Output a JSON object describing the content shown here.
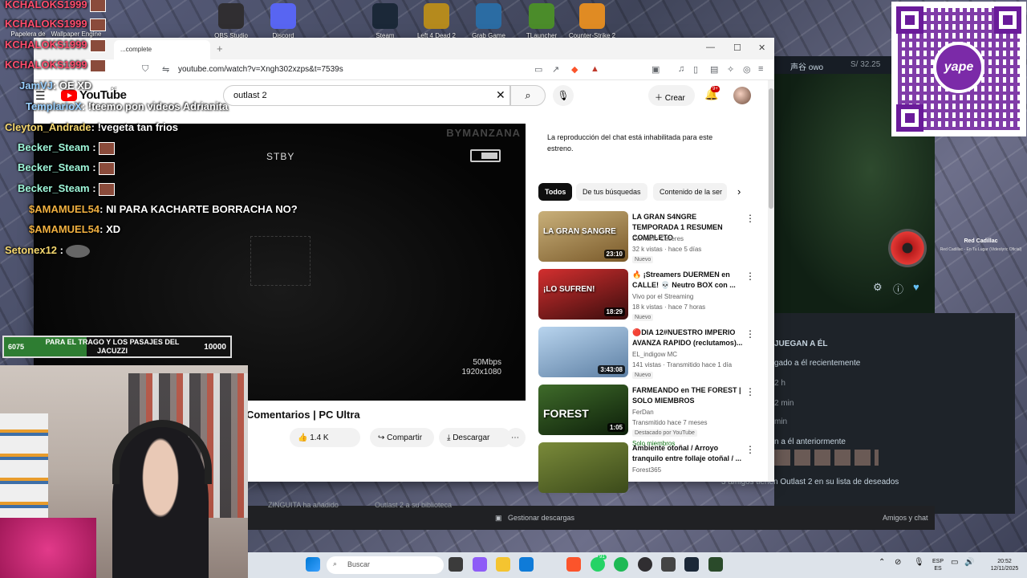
{
  "desktop": {
    "icons": [
      {
        "label": "OBS Studio",
        "color": "#302e31"
      },
      {
        "label": "Discord",
        "color": "#5865f2"
      },
      {
        "label": "Steam",
        "color": "#1b2838"
      },
      {
        "label": "Left 4 Dead 2",
        "color": "#b58a1d"
      },
      {
        "label": "Grab Game",
        "color": "#2b6ca3"
      },
      {
        "label": "TLauncher",
        "color": "#4b8c2a"
      },
      {
        "label": "Counter-Strike 2",
        "color": "#e08b23"
      }
    ],
    "left_labels": [
      "Papelera de",
      "Wallpaper Engine"
    ]
  },
  "browser": {
    "tab_title": "...complete",
    "url": "youtube.com/watch?v=Xngh302xzps&t=7539s"
  },
  "youtube": {
    "logo": "YouTube",
    "country": "PE",
    "search_value": "outlast 2",
    "create_label": "Crear",
    "notif_count": "9+",
    "player": {
      "brand": "BYMANZANA",
      "stby": "STBY",
      "bitrate": "50Mbps",
      "resolution": "1920x1080"
    },
    "video_title": "Comentarios | PC Ultra",
    "likes": "1.4 K",
    "share_label": "Compartir",
    "download_label": "Descargar",
    "chat_note": "La reproducción del chat está inhabilitada para este estreno.",
    "chips": [
      "Todos",
      "De tus búsquedas",
      "Contenido de la ser"
    ],
    "recommendations": [
      {
        "title": "LA GRAN S4NGRE TEMPORADA 1 RESUMEN COMPLETO",
        "channel": "Carnalito Caceres",
        "meta": "32 k vistas · hace 5 días",
        "badge": "Nuevo",
        "duration": "23:10",
        "thumb_text": "LA GRAN SANGRE",
        "c1": "#c9b07a",
        "c2": "#7a5a2a"
      },
      {
        "title": "🔥 ¡Streamers DUERMEN en CALLE! 💀 Neutro BOX con ...",
        "channel": "Vivo por el Streaming",
        "meta": "18 k vistas · hace 7 horas",
        "badge": "Nuevo",
        "duration": "18:29",
        "thumb_text": "¡LO SUFREN!",
        "c1": "#d32f2f",
        "c2": "#3a0d0d"
      },
      {
        "title": "🔴DIA 12#NUESTRO IMPERIO AVANZA RAPIDO (reclutamos)...",
        "channel": "EL_indigow MC",
        "meta": "141 vistas · Transmitido hace 1 día",
        "badge": "Nuevo",
        "duration": "3:43:08",
        "thumb_text": "",
        "c1": "#b8d4ee",
        "c2": "#5d7fa3"
      },
      {
        "title": "FARMEANDO en THE FOREST | SOLO MIEMBROS",
        "channel": "FerDan",
        "meta": "Transmitido hace 7 meses",
        "badge": "Destacado por YouTube",
        "extra": "Solo miembros",
        "duration": "1:05",
        "thumb_text": "FOREST",
        "c1": "#3f6b2a",
        "c2": "#0d1f0a"
      },
      {
        "title": "Ambiente otoñal / Arroyo tranquilo entre follaje otoñal / ...",
        "channel": "Forest365",
        "meta": "",
        "badge": "",
        "duration": "",
        "thumb_text": "",
        "c1": "#7a8a3a",
        "c2": "#3b4a1a"
      }
    ]
  },
  "overlay": {
    "top_names": [
      "KCHALOKS1999",
      "KCHALOKS1999",
      "KCHALOKS1999",
      "KCHALOKS1999"
    ],
    "chat": [
      {
        "name": "JamVJ",
        "msg": ": OE XD",
        "color": "#9ad0ff"
      },
      {
        "name": "TemplarioX",
        "msg": ": !teemo pon videos Adrianita",
        "color": "#9ad0ff"
      },
      {
        "name": "Cleyton_Andrade",
        "msg": ": !vegeta tan frios",
        "color": "#f5d76e"
      },
      {
        "name": "Becker_Steam",
        "msg": " :",
        "color": "#9ef5d8"
      },
      {
        "name": "Becker_Steam",
        "msg": " :",
        "color": "#9ef5d8"
      },
      {
        "name": "Becker_Steam",
        "msg": " :",
        "color": "#9ef5d8"
      },
      {
        "name": "$AMAMUEL54",
        "msg": ": NI PARA KACHARTE BORRACHA NO?",
        "color": "#f0b040"
      },
      {
        "name": "$AMAMUEL54",
        "msg": ": XD",
        "color": "#f0b040"
      },
      {
        "name": "Setonex12",
        "msg": " :",
        "color": "#f5d76e"
      }
    ],
    "goal": {
      "current": "6075",
      "target": "10000",
      "label": "PARA EL TRAGO Y LOS PASAJES DEL JACUZZI",
      "fraction": 0.6075
    }
  },
  "steam": {
    "user": "声谷 owo",
    "price": "S/ 32.25",
    "section": "JUEGAN A ÉL",
    "recent": "gado a él recientemente",
    "h": "2 h",
    "min1": "2 min",
    "min2": "min",
    "before": "n a él anteriormente",
    "wishlist": "3 amigos tienen Outlast 2 en su lista de deseados",
    "friend_added": "ZINGUITA ha añadido",
    "library": "Outlast 2 a su biblioteca",
    "manage": "Gestionar descargas",
    "friends_chat": "Amigos y chat"
  },
  "now_playing": {
    "title": "Red Cadillac",
    "subtitle": "Red Cadillac - En Tu Lugar (Videolyric Oficial)"
  },
  "qr": {
    "brand": "yape"
  },
  "taskbar": {
    "search": "Buscar",
    "lang1": "ESP",
    "lang2": "ES",
    "time": "20:52",
    "date": "12/11/2025",
    "badge": "91"
  }
}
